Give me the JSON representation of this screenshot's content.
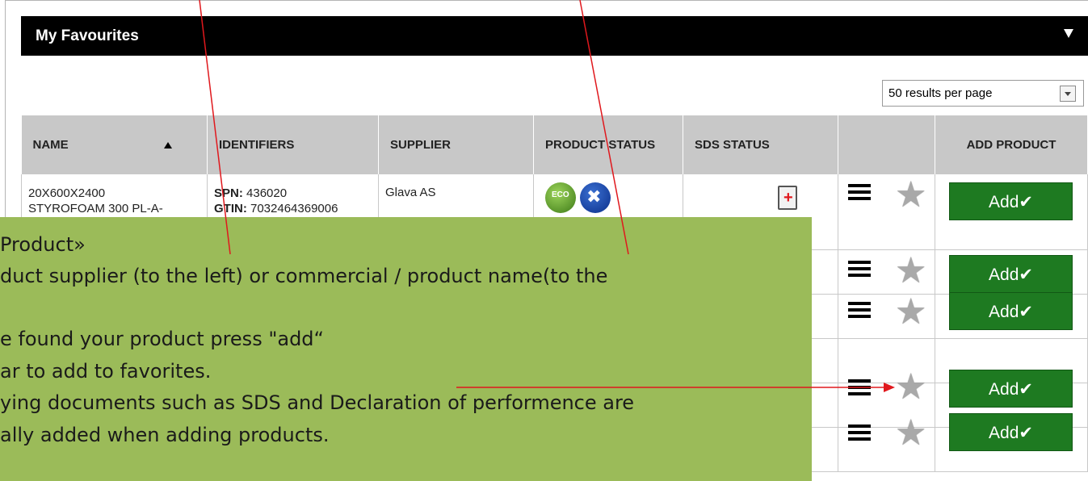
{
  "panel": {
    "title": "My Favourites"
  },
  "pagination": {
    "per_page": "50 results per page"
  },
  "table": {
    "headers": {
      "name": "NAME",
      "identifiers": "IDENTIFIERS",
      "supplier": "SUPPLIER",
      "product_status": "PRODUCT STATUS",
      "sds_status": "SDS STATUS",
      "actions": "",
      "add_product": "ADD PRODUCT"
    },
    "rows": [
      {
        "name_line1": "20X600X2400",
        "name_line2": "STYROFOAM 300 PL-A-",
        "spn_label": "SPN:",
        "spn": "436020",
        "gtin_label": "GTIN:",
        "gtin": "7032464369006",
        "supplier": "Glava AS",
        "status_icons": [
          "eco-icon",
          "tools-icon"
        ],
        "sds_icon": "sds-document-icon",
        "add_label": "Add✔"
      },
      {
        "add_label": "Add✔"
      },
      {
        "add_label": "Add✔"
      },
      {
        "add_label": "Add✔"
      },
      {
        "add_label": "Add✔"
      }
    ]
  },
  "callout": {
    "lines": [
      " Product»",
      "duct supplier (to the left) or commercial / product name(to the",
      "",
      "e found your product press \"add“",
      "ar to add to favorites.",
      "ying documents such as SDS and Declaration of performence are",
      "ally added when adding products."
    ]
  },
  "colors": {
    "header_bg": "#000000",
    "table_header_bg": "#c8c8c8",
    "add_button": "#1e7a21",
    "callout_bg": "#9bbb59",
    "annotation_line": "#e0181d"
  }
}
